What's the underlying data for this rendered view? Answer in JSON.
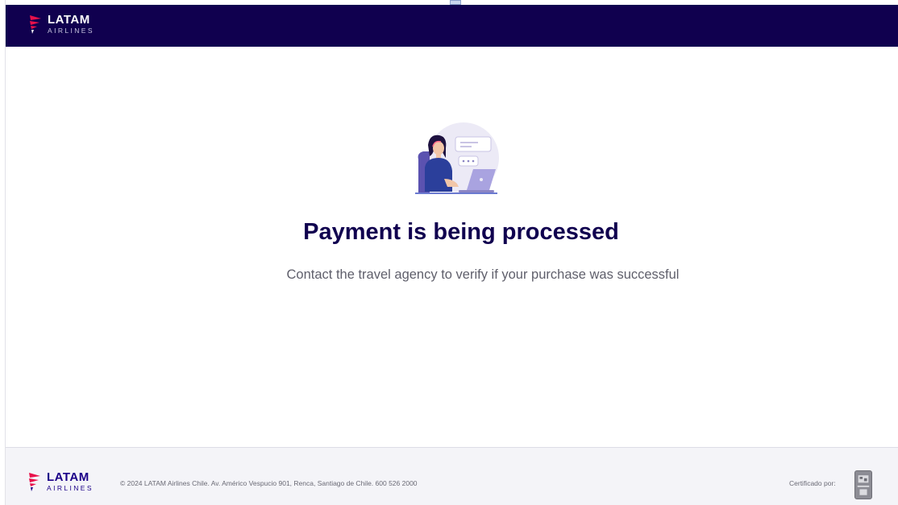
{
  "header": {
    "logo": {
      "brand": "LATAM",
      "sub": "AIRLINES",
      "icon": "latam-logo-icon"
    }
  },
  "main": {
    "illustration_icon": "support-agent-illustration-icon",
    "title": "Payment is being processed",
    "subtitle": "Contact the travel agency to verify if your purchase was successful"
  },
  "footer": {
    "logo": {
      "brand": "LATAM",
      "sub": "AIRLINES",
      "icon": "latam-logo-icon"
    },
    "copyright": "© 2024 LATAM Airlines Chile. Av. Américo Vespucio 901, Renca, Santiago de Chile. 600 526 2000",
    "certified_label": "Certificado por:",
    "cert_icon": "certificate-badge-icon"
  },
  "colors": {
    "header_bg": "#10004f",
    "title": "#10004f",
    "brand_blue": "#1b0088",
    "brand_red": "#e8114b",
    "footer_bg": "#f4f4f8"
  }
}
